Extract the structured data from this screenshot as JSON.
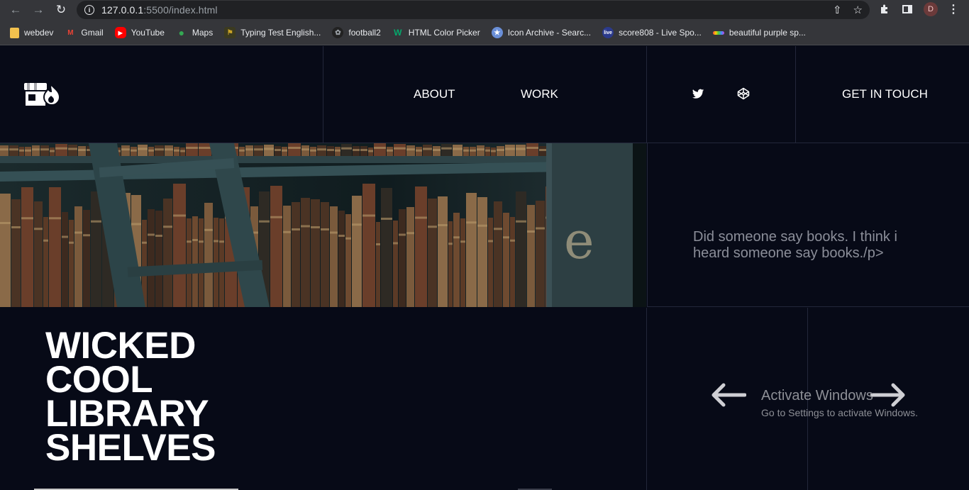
{
  "browser": {
    "url_host": "127.0.0.1",
    "url_rest": ":5500/index.html",
    "profile_initial": "D"
  },
  "bookmarks": [
    {
      "label": "webdev",
      "icon": "folder-icon",
      "color": "#f2c14e"
    },
    {
      "label": "Gmail",
      "icon": "gmail-icon",
      "color": "#ea4335"
    },
    {
      "label": "YouTube",
      "icon": "youtube-icon",
      "color": "#ff0000"
    },
    {
      "label": "Maps",
      "icon": "maps-icon",
      "color": "#34a853"
    },
    {
      "label": "Typing Test English...",
      "icon": "typing-icon",
      "color": "#c9a227"
    },
    {
      "label": "football2",
      "icon": "football-icon",
      "color": "#9aa0a6"
    },
    {
      "label": "HTML Color Picker",
      "icon": "w3-icon",
      "color": "#04aa6d"
    },
    {
      "label": "Icon Archive - Searc...",
      "icon": "star-icon",
      "color": "#6a8fd8"
    },
    {
      "label": "score808 - Live Spo...",
      "icon": "live-icon",
      "color": "#2b3a8c"
    },
    {
      "label": "beautiful purple sp...",
      "icon": "gradient-icon",
      "color": "#c04bd6"
    }
  ],
  "site": {
    "nav": {
      "about": "ABOUT",
      "work": "WORK"
    },
    "contact": "GET IN TOUCH",
    "hero_text": "Did someone say books. I think i heard someone say books./p>",
    "title_lines": [
      "WICKED",
      "COOL",
      "LIBRARY",
      "SHELVES"
    ]
  },
  "watermark": {
    "line1": "Activate Windows",
    "line2": "Go to Settings to activate Windows."
  },
  "colors": {
    "page_bg": "#070a17",
    "grid_line": "#23273a",
    "hero_text": "#8b8e99"
  }
}
